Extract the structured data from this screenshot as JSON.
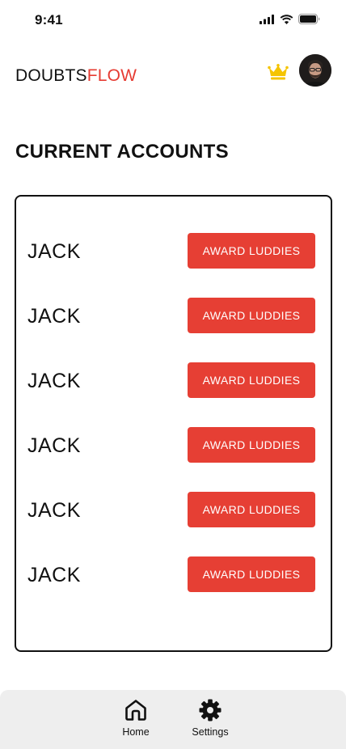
{
  "status_bar": {
    "time": "9:41",
    "icons": [
      "signal-icon",
      "wifi-icon",
      "battery-icon"
    ]
  },
  "header": {
    "brand_primary": "DOUBTS",
    "brand_accent": "FLOW",
    "brand_accent_color": "#e63b32",
    "premium_icon": "crown-icon",
    "crown_color": "#f5c400"
  },
  "page": {
    "title": "CURRENT ACCOUNTS"
  },
  "accounts": [
    {
      "name": "JACK",
      "action_label": "AWARD LUDDIES"
    },
    {
      "name": "JACK",
      "action_label": "AWARD LUDDIES"
    },
    {
      "name": "JACK",
      "action_label": "AWARD LUDDIES"
    },
    {
      "name": "JACK",
      "action_label": "AWARD LUDDIES"
    },
    {
      "name": "JACK",
      "action_label": "AWARD LUDDIES"
    },
    {
      "name": "JACK",
      "action_label": "AWARD LUDDIES"
    }
  ],
  "action_button_color": "#e63f34",
  "bottom_nav": {
    "items": [
      {
        "label": "Home",
        "icon": "home-icon"
      },
      {
        "label": "Settings",
        "icon": "gear-icon"
      }
    ]
  }
}
